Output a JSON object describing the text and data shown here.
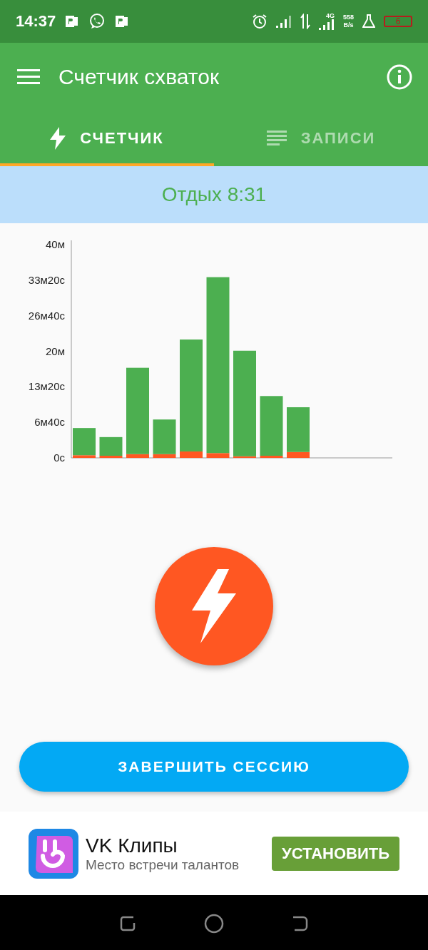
{
  "status_bar": {
    "time": "14:37",
    "network_type": "4G",
    "speed_value": "558",
    "speed_unit": "B/s",
    "battery": "6"
  },
  "app_bar": {
    "title": "Счетчик схваток"
  },
  "tabs": [
    {
      "label": "СЧЕТЧИК",
      "kind": "bolt",
      "selected": true
    },
    {
      "label": "ЗАПИСИ",
      "kind": "list",
      "selected": false
    }
  ],
  "rest_banner": {
    "text": "Отдых 8:31"
  },
  "chart": {
    "chart_data": {
      "type": "bar",
      "stacked": true,
      "ylim": [
        0,
        40
      ],
      "yticks": [
        {
          "value": 0,
          "label": "0с"
        },
        {
          "value": 6.67,
          "label": "6м40с"
        },
        {
          "value": 13.33,
          "label": "13м20с"
        },
        {
          "value": 20,
          "label": "20м"
        },
        {
          "value": 26.67,
          "label": "26м40с"
        },
        {
          "value": 33.33,
          "label": "33м20с"
        },
        {
          "value": 40,
          "label": "40м"
        }
      ],
      "series": [
        {
          "color": "#ff5722",
          "values": [
            0.5,
            0.4,
            0.7,
            0.7,
            1.2,
            0.9,
            0.3,
            0.4,
            1.1
          ]
        },
        {
          "color": "#4caf50",
          "values": [
            5.1,
            3.5,
            16.2,
            6.5,
            21.0,
            33.0,
            19.8,
            11.2,
            8.4
          ]
        }
      ]
    }
  },
  "end_button": {
    "label": "ЗАВЕРШИТЬ СЕССИЮ"
  },
  "ad": {
    "title": "VK Клипы",
    "subtitle": "Место встречи талантов",
    "button": "УСТАНОВИТЬ"
  }
}
